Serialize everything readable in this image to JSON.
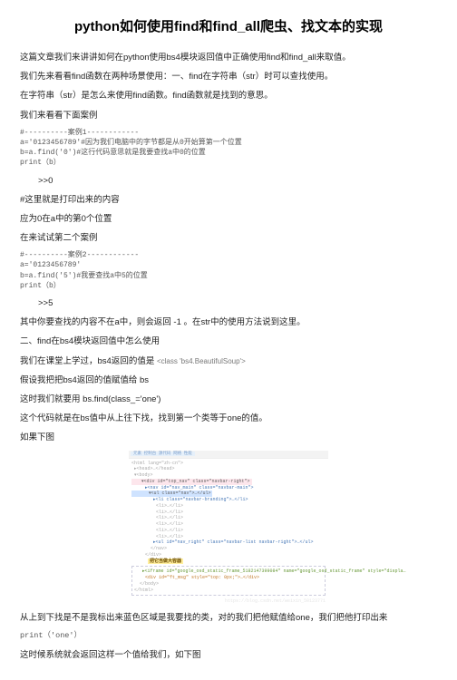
{
  "title": "python如何使用find和find_all爬虫、找文本的实现",
  "p1": "这篇文章我们来讲讲如何在python使用bs4模块返回值中正确使用find和find_all来取值。",
  "p2": "我们先来看看find函数在两种场景使用：一、find在字符串（str）时可以查找使用。",
  "p3": "在字符串（str）是怎么来使用find函数。find函数就是找到的意思。",
  "p4": "我们来看看下面案例",
  "code1": "#----------案例1------------\na='0123456789'#因为我们电脑中的字节都是从0开始算第一个位置\nb=a.find('0')#这行代码意思就是我要查找a中0的位置\nprint（b）",
  "out1": ">>0",
  "p5": "#这里就是打印出来的内容",
  "p6": "应为0在a中的第0个位置",
  "p7": "在来试试第二个案例",
  "code2": "#----------案例2------------\na='0123456789'\nb=a.find('5')#我要查找a中5的位置\nprint（b）",
  "out2": ">>5",
  "p8": "其中你要查找的内容不在a中，则会返回 -1 。在str中的使用方法说到这里。",
  "p9": "二、find在bs4模块返回值中怎么使用",
  "p10a": "我们在课堂上学过，bs4返回的值是 ",
  "p10b": "<class 'bs4.BeautifulSoup'>",
  "p11": "假设我把把bs4返回的值赋值给 bs",
  "p12": "这时我们就要用 bs.find(class_='one')",
  "p13": "这个代码就是在bs值中从上往下找，找到第一个类等于one的值。",
  "p14": "如果下图",
  "img": {
    "topbar": "元素    控制台    源代码    网络    性能",
    "l0": "<html lang=\"zh-cn\">",
    "l1": " ▸<head>…</head>",
    "l2": " ▾<body>",
    "l3": "   ▾<div id=\"top_nav\" class=\"navbar-right\">",
    "l4": "     ▸<nav id=\"nav_main\" class=\"navbar-main\">",
    "l5": "      ▾<ul class=\"nav\">…</ul>",
    "l6": "        ▸<li class=\"navbar-branding\">…</li>",
    "l7": "         <li>…</li>",
    "l8": "         <li>…</li>",
    "l9": "         <li>…</li>",
    "l10": "         <li>…</li>",
    "l11": "         <li>…</li>",
    "l12": "         <li>…</li>",
    "l13": "        ▸<ul id=\"nav_right\" class=\"navbar-list navbar-right\">…</ul>",
    "l14": "       </nav>",
    "l15": "     </div>",
    "hl": "把它当做大容器",
    "l16": "   ▸<iframe id=\"google_osd_static_frame_5182147399084\" name=\"google_osd_static_frame\" style=\"displa…",
    "l17": "    <div id=\"ft_msg\" style=\"top: 0px;\">…</div>",
    "l18": "  </body>",
    "l19": "</html>",
    "watermark": "https://blog.csdn.net/weixin_50123771"
  },
  "p15": "从上到下找是不是我标出来蓝色区域是我要找的类，对的我们把他赋值给one，我们把他打印出来",
  "print1": "print（'one'）",
  "p16": "这时候系统就会返回这样一个值给我们，如下图"
}
